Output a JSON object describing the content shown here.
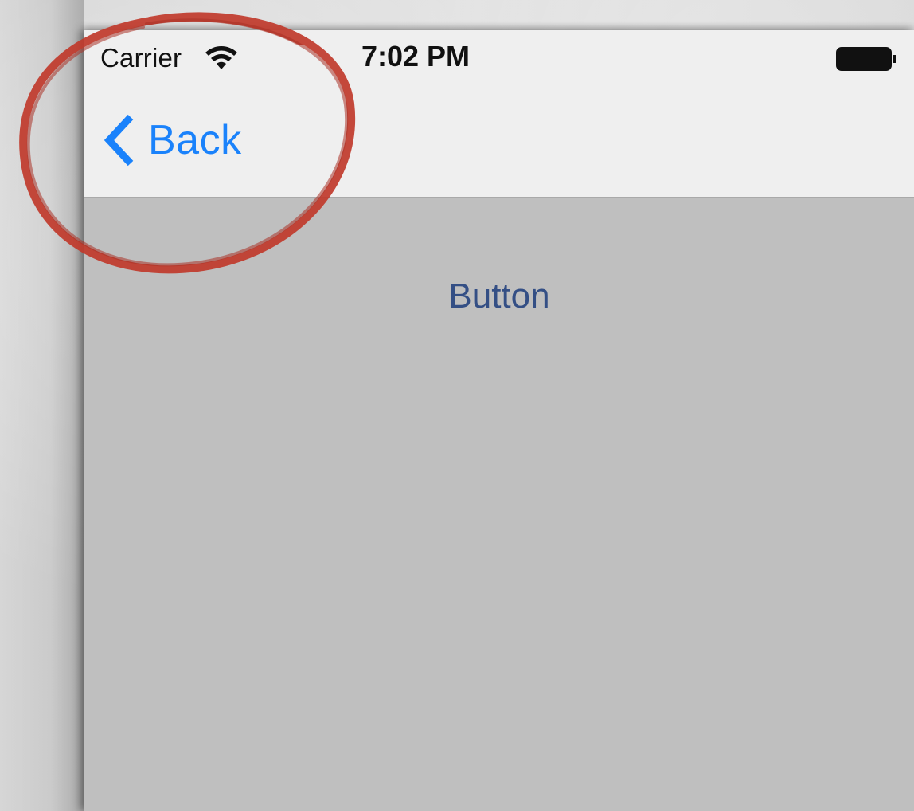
{
  "status_bar": {
    "carrier": "Carrier",
    "time": "7:02 PM",
    "wifi_icon": "wifi-icon",
    "battery_icon": "battery-full-icon"
  },
  "nav_bar": {
    "back_label": "Back",
    "back_icon": "chevron-left-icon"
  },
  "content": {
    "button_label": "Button"
  },
  "colors": {
    "accent": "#1a82fb",
    "button_text": "#344f85",
    "content_background": "#bfbfbf",
    "bar_background": "#efefef",
    "annotation": "#c0392b"
  }
}
